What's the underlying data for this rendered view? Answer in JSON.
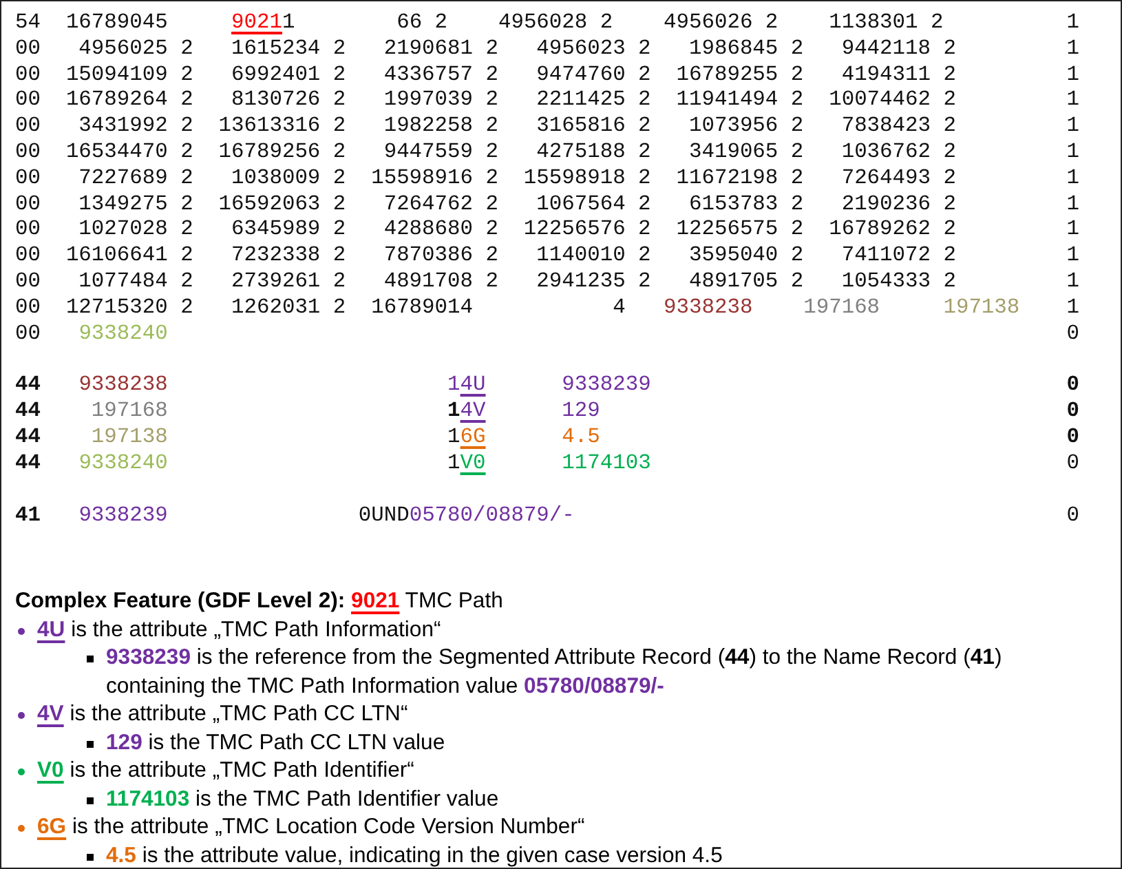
{
  "record_groups": [
    {
      "lines": [
        {
          "segments": [
            "54  16789045     ",
            {
              "text": "9021",
              "color": "#ff0000",
              "underline": true
            },
            "1        66 2    4956028 2    4956026 2    1138301 2"
          ],
          "flag": {
            "text": "1",
            "bold": false
          }
        },
        {
          "segments": [
            "00   4956025 2   1615234 2   2190681 2   4956023 2   1986845 2   9442118 2"
          ],
          "flag": {
            "text": "1",
            "bold": false
          }
        },
        {
          "segments": [
            "00  15094109 2   6992401 2   4336757 2   9474760 2  16789255 2   4194311 2"
          ],
          "flag": {
            "text": "1",
            "bold": false
          }
        },
        {
          "segments": [
            "00  16789264 2   8130726 2   1997039 2   2211425 2  11941494 2  10074462 2"
          ],
          "flag": {
            "text": "1",
            "bold": false
          }
        },
        {
          "segments": [
            "00   3431992 2  13613316 2   1982258 2   3165816 2   1073956 2   7838423 2"
          ],
          "flag": {
            "text": "1",
            "bold": false
          }
        },
        {
          "segments": [
            "00  16534470 2  16789256 2   9447559 2   4275188 2   3419065 2   1036762 2"
          ],
          "flag": {
            "text": "1",
            "bold": false
          }
        },
        {
          "segments": [
            "00   7227689 2   1038009 2  15598916 2  15598918 2  11672198 2   7264493 2"
          ],
          "flag": {
            "text": "1",
            "bold": false
          }
        },
        {
          "segments": [
            "00   1349275 2  16592063 2   7264762 2   1067564 2   6153783 2   2190236 2"
          ],
          "flag": {
            "text": "1",
            "bold": false
          }
        },
        {
          "segments": [
            "00   1027028 2   6345989 2   4288680 2  12256576 2  12256575 2  16789262 2"
          ],
          "flag": {
            "text": "1",
            "bold": false
          }
        },
        {
          "segments": [
            "00  16106641 2   7232338 2   7870386 2   1140010 2   3595040 2   7411072 2"
          ],
          "flag": {
            "text": "1",
            "bold": false
          }
        },
        {
          "segments": [
            "00   1077484 2   2739261 2   4891708 2   2941235 2   4891705 2   1054333 2"
          ],
          "flag": {
            "text": "1",
            "bold": false
          }
        },
        {
          "segments": [
            "00  12715320 2   1262031 2  16789014           4   ",
            {
              "text": "9338238",
              "color": "#993333"
            },
            {
              "text": "    197168",
              "color": "#808080"
            },
            {
              "text": "     197138",
              "color": "#a39e6a"
            }
          ],
          "flag": {
            "text": "1",
            "bold": false
          }
        },
        {
          "segments": [
            "00   ",
            {
              "text": "9338240",
              "color": "#9bbb59"
            }
          ],
          "flag": {
            "text": "0",
            "bold": false
          }
        }
      ]
    },
    {
      "lines": [
        {
          "segments": [
            {
              "text": "44",
              "bold": true
            },
            {
              "text": "   9338238",
              "color": "#993333"
            },
            {
              "text": "                      1",
              "color": "#7030a0"
            },
            {
              "text": "4U",
              "color": "#7030a0",
              "underline": true
            },
            {
              "text": "      9338239",
              "color": "#7030a0"
            }
          ],
          "flag": {
            "text": "0",
            "bold": true
          }
        },
        {
          "segments": [
            {
              "text": "44",
              "bold": true
            },
            {
              "text": "    197168",
              "color": "#808080"
            },
            {
              "text": "                      1",
              "bold": true
            },
            {
              "text": "4V",
              "color": "#7030a0",
              "underline": true
            },
            {
              "text": "      129",
              "color": "#7030a0"
            }
          ],
          "flag": {
            "text": "0",
            "bold": true
          }
        },
        {
          "segments": [
            {
              "text": "44",
              "bold": true
            },
            {
              "text": "    197138",
              "color": "#a39e6a"
            },
            "                      1",
            {
              "text": "6G",
              "color": "#e46c0a",
              "underline": true
            },
            {
              "text": "      4.5",
              "color": "#e46c0a"
            }
          ],
          "flag": {
            "text": "0",
            "bold": true
          }
        },
        {
          "segments": [
            {
              "text": "44",
              "bold": true
            },
            {
              "text": "   9338240",
              "color": "#9bbb59"
            },
            "                      1",
            {
              "text": "V0",
              "color": "#00b050",
              "underline": true
            },
            {
              "text": "      1174103",
              "color": "#00b050"
            }
          ],
          "flag": {
            "text": "0",
            "bold": false
          }
        }
      ]
    },
    {
      "lines": [
        {
          "segments": [
            {
              "text": "41",
              "bold": true
            },
            {
              "text": "   9338239",
              "color": "#7030a0"
            },
            "               0UND",
            {
              "text": "05780/08879/-",
              "color": "#7030a0"
            }
          ],
          "flag": {
            "text": "0",
            "bold": false
          }
        }
      ]
    }
  ],
  "notes": {
    "heading": [
      {
        "text": "Complex Feature (GDF Level 2): ",
        "bold": true
      },
      {
        "text": "9021",
        "color": "#ff0000",
        "bold": true,
        "underline": true
      },
      {
        "text": " TMC Path"
      }
    ],
    "items": [
      {
        "color": "#7030a0",
        "segments": [
          {
            "text": "4U",
            "color": "#7030a0",
            "bold": true,
            "underline": true
          },
          " is the attribute „TMC Path Information“"
        ],
        "children": [
          {
            "segments": [
              {
                "text": "9338239",
                "color": "#7030a0",
                "bold": true
              },
              " is the reference from the Segmented Attribute Record (",
              {
                "text": "44",
                "bold": true
              },
              ") to the Name Record (",
              {
                "text": "41",
                "bold": true
              },
              ") containing the TMC Path Information value ",
              {
                "text": "05780/08879/-",
                "color": "#7030a0",
                "bold": true
              }
            ]
          }
        ]
      },
      {
        "color": "#7030a0",
        "segments": [
          {
            "text": "4V",
            "color": "#7030a0",
            "bold": true,
            "underline": true
          },
          " is the attribute „TMC Path CC LTN“"
        ],
        "children": [
          {
            "segments": [
              {
                "text": "129",
                "color": "#7030a0",
                "bold": true
              },
              " is the TMC Path CC LTN value"
            ]
          }
        ]
      },
      {
        "color": "#00b050",
        "segments": [
          {
            "text": "V0",
            "color": "#00b050",
            "bold": true,
            "underline": true
          },
          " is the attribute „TMC Path Identifier“"
        ],
        "children": [
          {
            "segments": [
              {
                "text": "1174103",
                "color": "#00b050",
                "bold": true
              },
              " is the TMC Path Identifier value"
            ]
          }
        ]
      },
      {
        "color": "#e46c0a",
        "segments": [
          {
            "text": "6G",
            "color": "#e46c0a",
            "bold": true,
            "underline": true
          },
          " is the attribute „TMC Location Code Version Number“"
        ],
        "children": [
          {
            "segments": [
              {
                "text": "4.5",
                "color": "#e46c0a",
                "bold": true
              },
              " is the attribute value, indicating in the given case version 4.5"
            ]
          }
        ]
      }
    ]
  }
}
